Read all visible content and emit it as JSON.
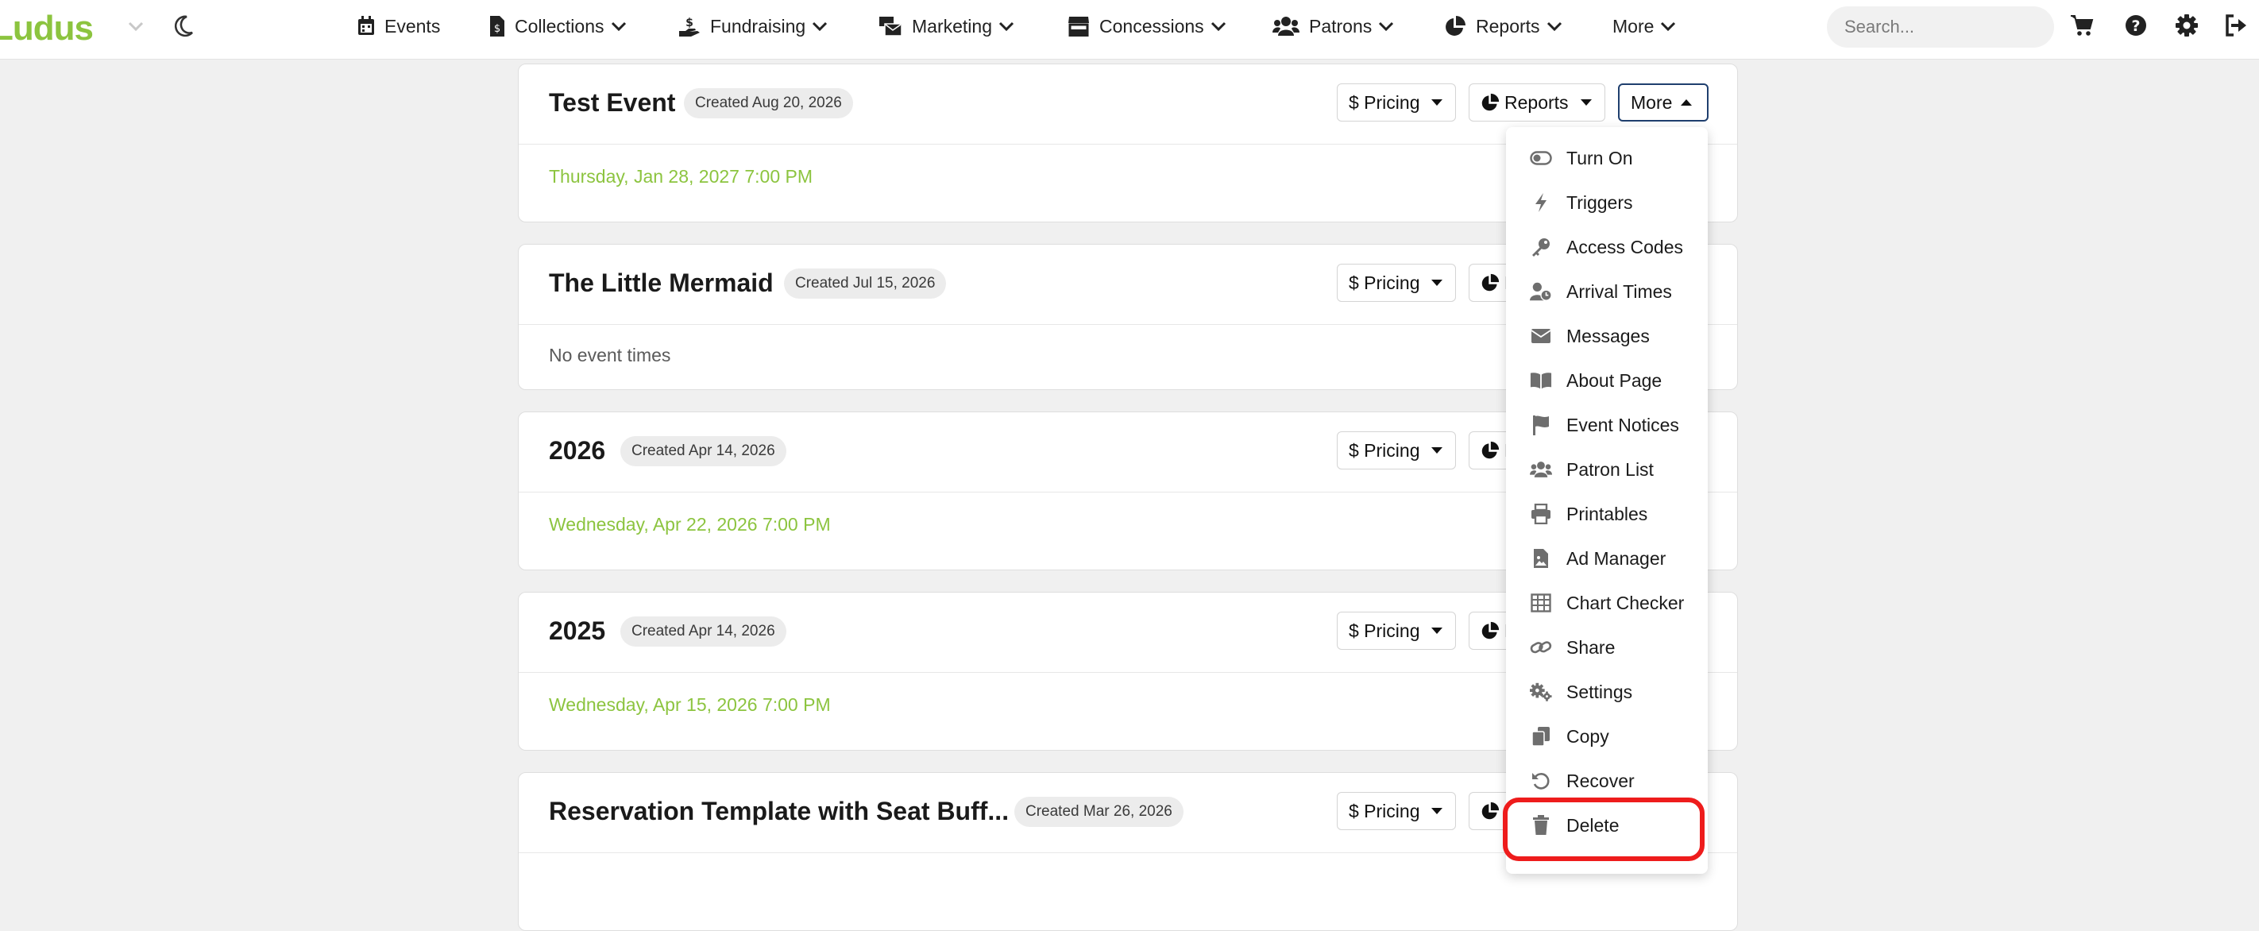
{
  "brand": {
    "name": "Ludus"
  },
  "nav": [
    {
      "label": "Events",
      "icon": "calendar-icon"
    },
    {
      "label": "Collections",
      "icon": "file-invoice-icon"
    },
    {
      "label": "Fundraising",
      "icon": "hand-holding-dollar-icon"
    },
    {
      "label": "Marketing",
      "icon": "mail-bulk-icon"
    },
    {
      "label": "Concessions",
      "icon": "store-icon"
    },
    {
      "label": "Patrons",
      "icon": "users-icon"
    },
    {
      "label": "Reports",
      "icon": "chart-pie-icon"
    },
    {
      "label": "More"
    }
  ],
  "search": {
    "placeholder": "Search..."
  },
  "colors": {
    "brand_green": "#8cc43f",
    "more_button_border": "#1f3f6e",
    "highlight": "#ee1c1c"
  },
  "buttons": {
    "pricing": "$ Pricing",
    "reports": "Reports",
    "more": "More"
  },
  "events": [
    {
      "title": "Test Event",
      "created": "Created Aug 20, 2026",
      "time": "Thursday, Jan 28, 2027 7:00 PM"
    },
    {
      "title": "The Little Mermaid",
      "created": "Created Jul 15, 2026",
      "time": "No event times"
    },
    {
      "title": "2026",
      "created": "Created Apr 14, 2026",
      "time": "Wednesday, Apr 22, 2026 7:00 PM"
    },
    {
      "title": "2025",
      "created": "Created Apr 14, 2026",
      "time": "Wednesday, Apr 15, 2026 7:00 PM"
    },
    {
      "title": "Reservation Template with Seat Buff...",
      "created": "Created Mar 26, 2026",
      "time": ""
    }
  ],
  "more_menu": [
    {
      "label": "Turn On",
      "icon": "toggle-off-icon"
    },
    {
      "label": "Triggers",
      "icon": "bolt-icon"
    },
    {
      "label": "Access Codes",
      "icon": "key-icon"
    },
    {
      "label": "Arrival Times",
      "icon": "user-clock-icon"
    },
    {
      "label": "Messages",
      "icon": "envelope-icon"
    },
    {
      "label": "About Page",
      "icon": "book-open-icon"
    },
    {
      "label": "Event Notices",
      "icon": "flag-icon"
    },
    {
      "label": "Patron List",
      "icon": "users-icon"
    },
    {
      "label": "Printables",
      "icon": "print-icon"
    },
    {
      "label": "Ad Manager",
      "icon": "file-image-icon"
    },
    {
      "label": "Chart Checker",
      "icon": "table-icon"
    },
    {
      "label": "Share",
      "icon": "link-icon"
    },
    {
      "label": "Settings",
      "icon": "cogs-icon"
    },
    {
      "label": "Copy",
      "icon": "copy-icon"
    },
    {
      "label": "Recover",
      "icon": "undo-icon"
    },
    {
      "label": "Delete",
      "icon": "trash-icon"
    }
  ]
}
